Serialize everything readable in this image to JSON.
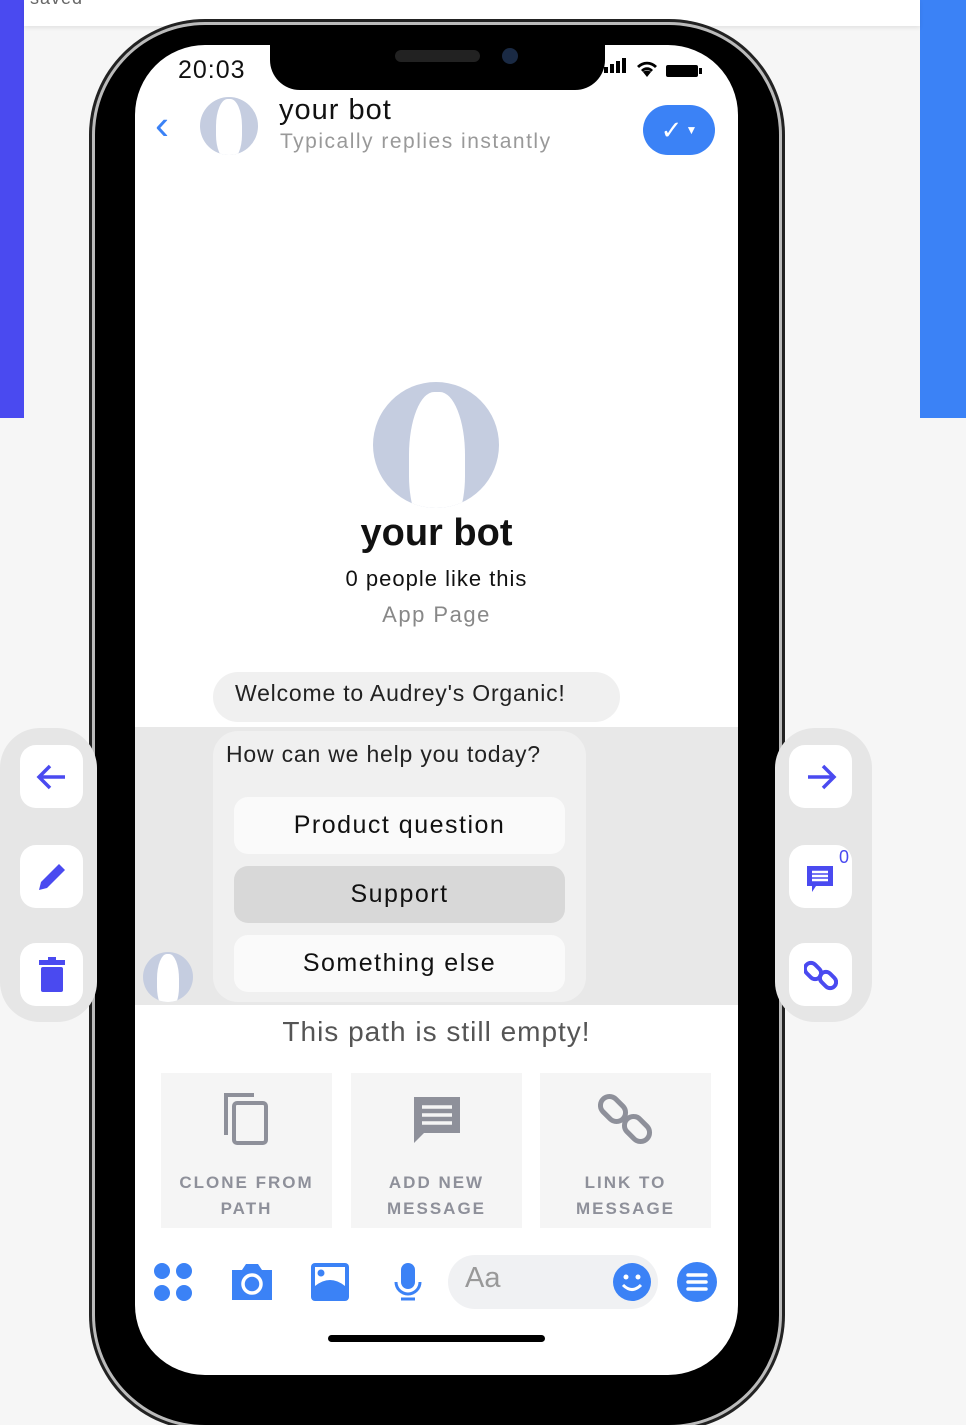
{
  "top_bar": {
    "status_text": "saved"
  },
  "phone_status": {
    "time": "20:03"
  },
  "chat_header": {
    "name": "your bot",
    "subtitle": "Typically replies instantly"
  },
  "profile": {
    "name": "your bot",
    "likes": "0 people like this",
    "page_type": "App Page"
  },
  "messages": {
    "welcome": "Welcome to Audrey's Organic!",
    "question": "How can we help you today?",
    "quick_replies": [
      {
        "label": "Product question",
        "selected": false
      },
      {
        "label": "Support",
        "selected": true
      },
      {
        "label": "Something else",
        "selected": false
      }
    ]
  },
  "empty_state": {
    "text": "This path is still empty!",
    "actions": [
      {
        "label_line1": "CLONE FROM",
        "label_line2": "PATH",
        "icon": "copy-icon"
      },
      {
        "label_line1": "ADD NEW",
        "label_line2": "MESSAGE",
        "icon": "message-icon"
      },
      {
        "label_line1": "LINK TO",
        "label_line2": "MESSAGE",
        "icon": "link-icon"
      }
    ]
  },
  "side_panel_right": {
    "message_count": "0"
  },
  "composer": {
    "placeholder": "Aa"
  },
  "colors": {
    "accent": "#3b82f6",
    "panel_accent": "#4a4af0",
    "icon_gray": "#8e909a"
  }
}
